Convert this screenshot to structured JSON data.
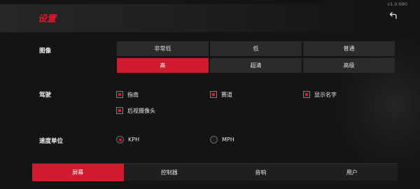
{
  "header": {
    "title": "设置",
    "version": "v1.0.680"
  },
  "graphics": {
    "label": "图像",
    "options": [
      "非常低",
      "低",
      "普通",
      "高",
      "超清",
      "高级"
    ],
    "selected": "高"
  },
  "driving": {
    "label": "驾驶",
    "options": [
      {
        "label": "指南",
        "checked": true
      },
      {
        "label": "赛道",
        "checked": true
      },
      {
        "label": "显示名字",
        "checked": true
      },
      {
        "label": "后视摄像头",
        "checked": true
      }
    ]
  },
  "speed_unit": {
    "label": "速度单位",
    "options": [
      "KPH",
      "MPH"
    ],
    "selected": "KPH"
  },
  "tabs": {
    "items": [
      "屏幕",
      "控制器",
      "音响",
      "用户"
    ],
    "active": "屏幕"
  },
  "colors": {
    "accent": "#e8132b",
    "active_bg": "#d01a2e",
    "background": "#141414"
  }
}
